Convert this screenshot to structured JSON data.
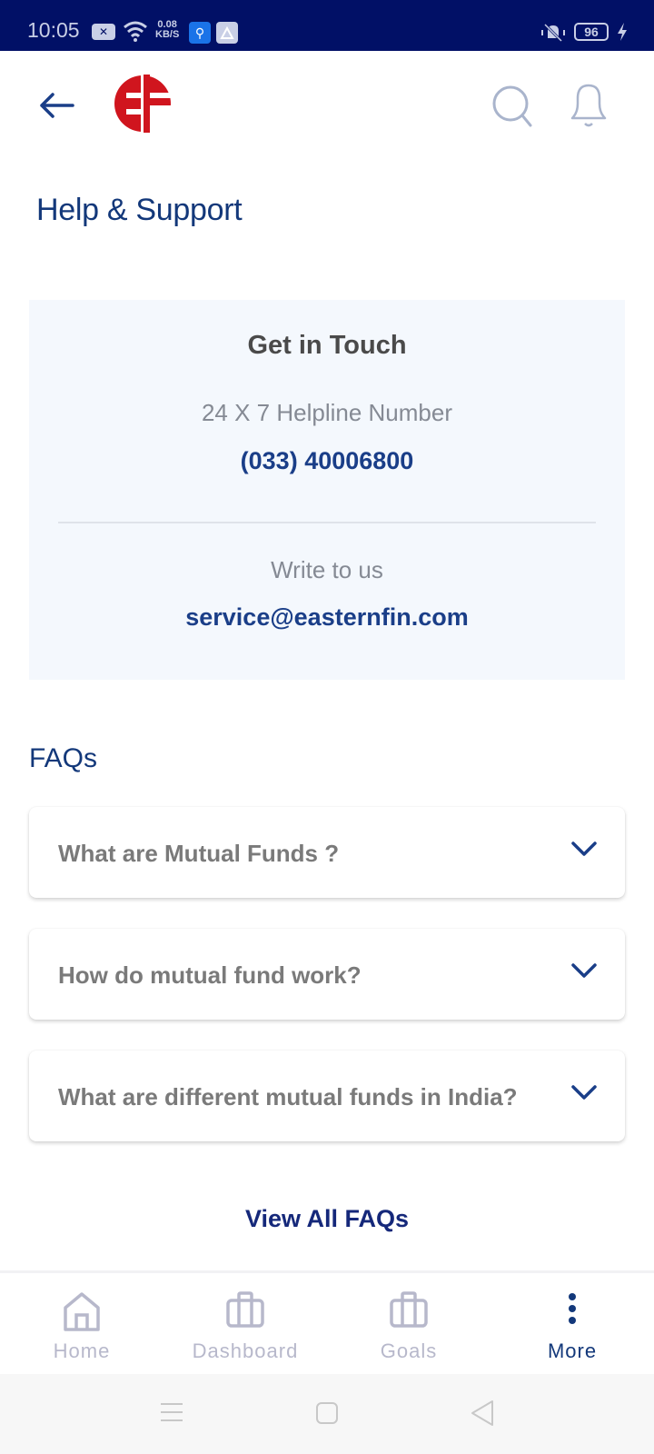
{
  "status_bar": {
    "time": "10:05",
    "net_speed_value": "0.08",
    "net_speed_unit": "KB/S",
    "battery": "96",
    "icons": [
      "notification-x-icon",
      "wifi-icon",
      "usb-icon",
      "share-icon",
      "mute-vibrate-icon",
      "battery-icon",
      "charging-bolt-icon"
    ]
  },
  "app_bar": {
    "logo_text": "EF",
    "icons": [
      "back-arrow-icon",
      "search-icon",
      "bell-icon"
    ]
  },
  "page": {
    "title": "Help & Support"
  },
  "contact": {
    "title": "Get in Touch",
    "helpline_label": "24 X 7 Helpline Number",
    "helpline_number": "(033) 40006800",
    "write_label": "Write to us",
    "email": "service@easternfin.com"
  },
  "faqs": {
    "title": "FAQs",
    "items": [
      {
        "question": "What are Mutual Funds ?"
      },
      {
        "question": "How do mutual fund work?"
      },
      {
        "question": "What are different mutual funds in India?"
      }
    ],
    "view_all_label": "View All FAQs"
  },
  "bottom_nav": {
    "items": [
      {
        "label": "Home",
        "icon": "home-icon",
        "active": false
      },
      {
        "label": "Dashboard",
        "icon": "briefcase-icon",
        "active": false
      },
      {
        "label": "Goals",
        "icon": "briefcase-icon",
        "active": false
      },
      {
        "label": "More",
        "icon": "more-vertical-icon",
        "active": true
      }
    ]
  },
  "colors": {
    "status_bar_bg": "#011066",
    "brand_red": "#d0151e",
    "primary_blue": "#13387a",
    "card_bg": "#f4f8fd",
    "inactive_nav": "#b7b8cb"
  }
}
